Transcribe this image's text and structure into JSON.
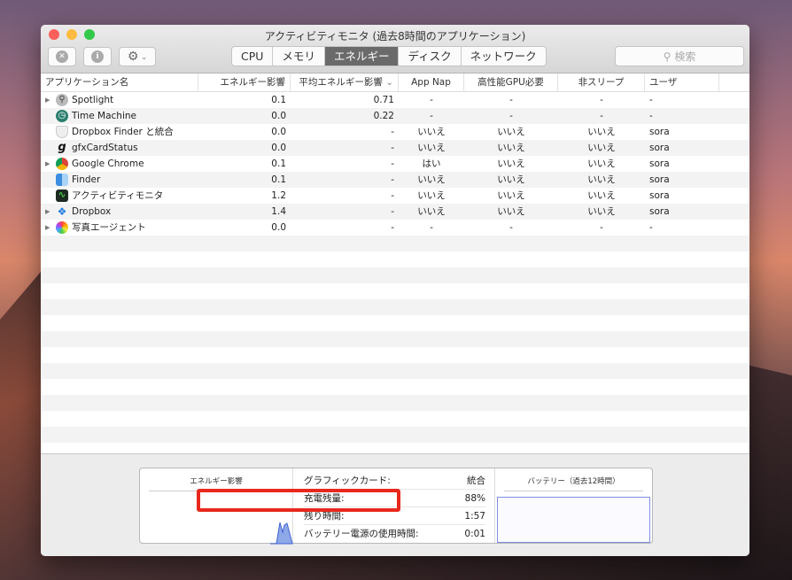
{
  "window": {
    "title": "アクティビティモニタ (過去8時間のアプリケーション)"
  },
  "toolbar": {
    "tabs": [
      "CPU",
      "メモリ",
      "エネルギー",
      "ディスク",
      "ネットワーク"
    ],
    "active_tab": "エネルギー",
    "search_placeholder": "検索"
  },
  "table": {
    "columns": [
      "アプリケーション名",
      "エネルギー影響",
      "平均エネルギー影響",
      "App Nap",
      "高性能GPU必要",
      "非スリープ",
      "ユーザ"
    ],
    "sort_column": "平均エネルギー影響",
    "rows": [
      {
        "expand": true,
        "icon": "spotlight-icon",
        "name": "Spotlight",
        "energy": "0.1",
        "avg": "0.71",
        "nap": "-",
        "gpu": "-",
        "sleep": "-",
        "user": "-"
      },
      {
        "expand": false,
        "icon": "time-machine-icon",
        "name": "Time Machine",
        "energy": "0.0",
        "avg": "0.22",
        "nap": "-",
        "gpu": "-",
        "sleep": "-",
        "user": "-"
      },
      {
        "expand": false,
        "icon": "dropbox-finder-icon",
        "name": "Dropbox Finder と統合",
        "energy": "0.0",
        "avg": "-",
        "nap": "いいえ",
        "gpu": "いいえ",
        "sleep": "いいえ",
        "user": "sora"
      },
      {
        "expand": false,
        "icon": "gfxcardstatus-icon",
        "name": "gfxCardStatus",
        "energy": "0.0",
        "avg": "-",
        "nap": "いいえ",
        "gpu": "いいえ",
        "sleep": "いいえ",
        "user": "sora"
      },
      {
        "expand": true,
        "icon": "chrome-icon",
        "name": "Google Chrome",
        "energy": "0.1",
        "avg": "-",
        "nap": "はい",
        "gpu": "いいえ",
        "sleep": "いいえ",
        "user": "sora"
      },
      {
        "expand": false,
        "icon": "finder-icon",
        "name": "Finder",
        "energy": "0.1",
        "avg": "-",
        "nap": "いいえ",
        "gpu": "いいえ",
        "sleep": "いいえ",
        "user": "sora"
      },
      {
        "expand": false,
        "icon": "activity-monitor-icon",
        "name": "アクティビティモニタ",
        "energy": "1.2",
        "avg": "-",
        "nap": "いいえ",
        "gpu": "いいえ",
        "sleep": "いいえ",
        "user": "sora"
      },
      {
        "expand": true,
        "icon": "dropbox-icon",
        "name": "Dropbox",
        "energy": "1.4",
        "avg": "-",
        "nap": "いいえ",
        "gpu": "いいえ",
        "sleep": "いいえ",
        "user": "sora"
      },
      {
        "expand": true,
        "icon": "photos-agent-icon",
        "name": "写真エージェント",
        "energy": "0.0",
        "avg": "-",
        "nap": "-",
        "gpu": "-",
        "sleep": "-",
        "user": "-"
      }
    ]
  },
  "summary": {
    "energy_title": "エネルギー影響",
    "battery_title": "バッテリー（過去12時間）",
    "items": [
      {
        "label": "グラフィックカード:",
        "value": "統合"
      },
      {
        "label": "充電残量:",
        "value": "88%"
      },
      {
        "label": "残り時間:",
        "value": "1:57"
      },
      {
        "label": "バッテリー電源の使用時間:",
        "value": "0:01"
      }
    ],
    "highlighted": "残り時間:",
    "highlight_color": "#e8281c"
  }
}
